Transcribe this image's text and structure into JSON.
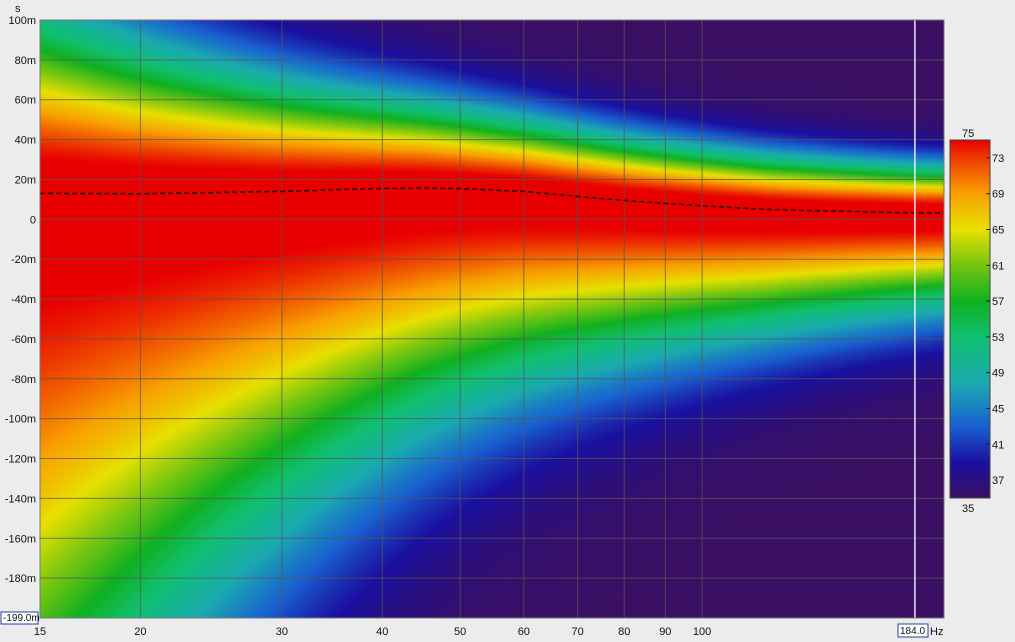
{
  "chart_data": {
    "type": "heatmap",
    "title": "",
    "x": {
      "label": "Hz",
      "scale": "log",
      "range": [
        15,
        200
      ],
      "ticks": [
        15,
        20,
        30,
        40,
        50,
        60,
        70,
        80,
        90,
        100
      ],
      "tick_labels": [
        "15",
        "20",
        "30",
        "40",
        "50",
        "60",
        "70",
        "80",
        "90",
        "100"
      ]
    },
    "y": {
      "label": "s",
      "range": [
        -0.2,
        0.1
      ],
      "ticks": [
        0.1,
        0.08,
        0.06,
        0.04,
        0.02,
        0,
        -0.02,
        -0.04,
        -0.06,
        -0.08,
        -0.1,
        -0.12,
        -0.14,
        -0.16,
        -0.18
      ],
      "tick_labels": [
        "100m",
        "80m",
        "60m",
        "40m",
        "20m",
        "0",
        "-20m",
        "-40m",
        "-60m",
        "-80m",
        "-100m",
        "-120m",
        "-140m",
        "-160m",
        "-180m"
      ]
    },
    "grid": true,
    "colorbar": {
      "min_label": "35",
      "max_label": "75",
      "range": [
        35,
        75
      ],
      "ticks": [
        73,
        69,
        65,
        61,
        57,
        53,
        49,
        45,
        41,
        37
      ],
      "tick_labels": [
        "73",
        "69",
        "65",
        "61",
        "57",
        "53",
        "49",
        "45",
        "41",
        "37"
      ],
      "placement": "right",
      "colors": [
        "#3a0f63",
        "#1a10a0",
        "#1960d0",
        "#1aaab0",
        "#10c070",
        "#10b020",
        "#80c810",
        "#e8e000",
        "#f8a000",
        "#f05000",
        "#e80000"
      ]
    },
    "peak_trace": {
      "style": "dashed",
      "color": "#2a0a00",
      "x": [
        15,
        20,
        30,
        40,
        45,
        50,
        60,
        70,
        80,
        90,
        100,
        120,
        150,
        184,
        200
      ],
      "y": [
        0.013,
        0.0128,
        0.014,
        0.0155,
        0.0158,
        0.0154,
        0.014,
        0.0115,
        0.0095,
        0.008,
        0.0068,
        0.005,
        0.004,
        0.0033,
        0.0032
      ]
    },
    "cursor": {
      "x": 184.0,
      "x_readout": "184.0",
      "y_readout": "-199.0m"
    }
  }
}
